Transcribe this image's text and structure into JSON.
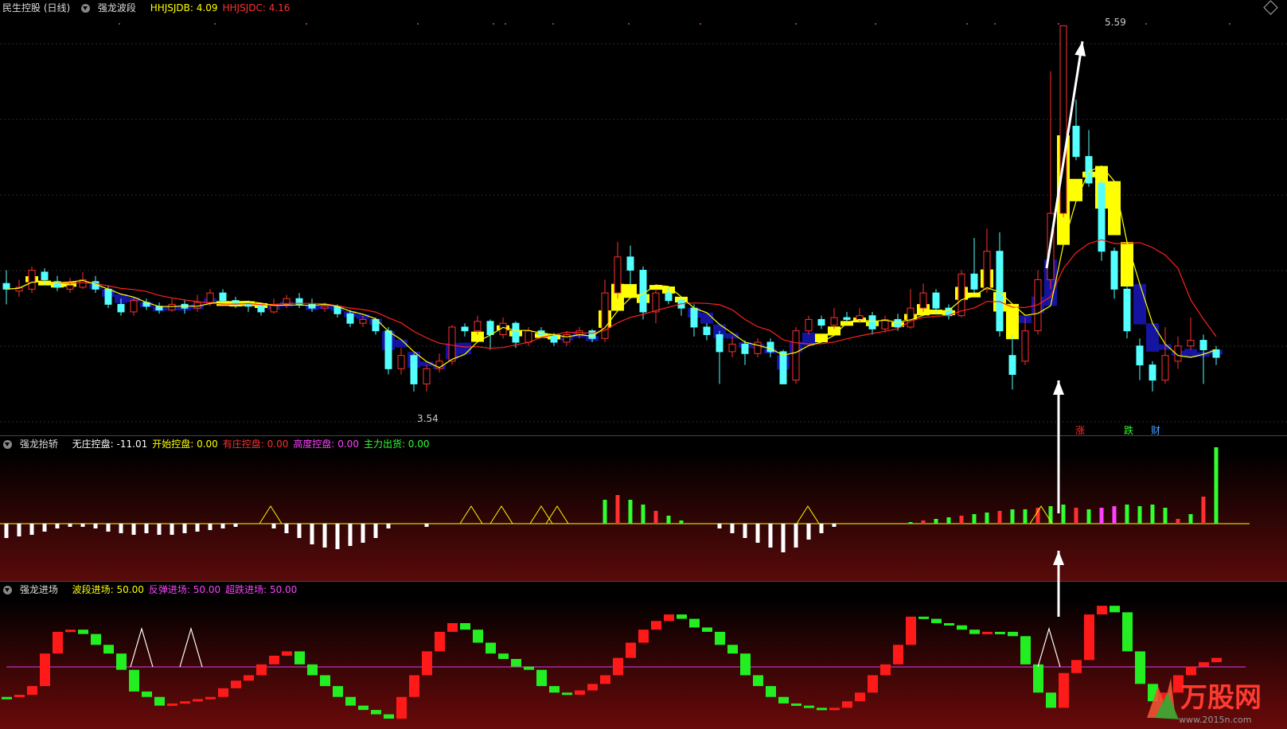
{
  "main": {
    "title": "民生控股 (日线)",
    "indicator_name": "强龙波段",
    "fields": [
      {
        "label": "HHJSJDB:",
        "value": "4.09",
        "color": "#ffff00"
      },
      {
        "label": "HHJSJDC:",
        "value": "4.16",
        "color": "#ff3030"
      }
    ],
    "high_label": "5.59",
    "low_label": "3.54",
    "signals": [
      {
        "text": "涨",
        "color": "#ff3030"
      },
      {
        "text": "跌",
        "color": "#30ff30"
      },
      {
        "text": "财",
        "color": "#4aa3ff"
      }
    ]
  },
  "ind1": {
    "name": "强龙抬轿",
    "fields": [
      {
        "label": "无庄控盘:",
        "value": "-11.01",
        "color": "#ffffff"
      },
      {
        "label": "开始控盘:",
        "value": "0.00",
        "color": "#ffff00"
      },
      {
        "label": "有庄控盘:",
        "value": "0.00",
        "color": "#ff3030"
      },
      {
        "label": "高度控盘:",
        "value": "0.00",
        "color": "#ff40ff"
      },
      {
        "label": "主力出货:",
        "value": "0.00",
        "color": "#30ff30"
      }
    ]
  },
  "ind2": {
    "name": "强龙进场",
    "fields": [
      {
        "label": "波段进场:",
        "value": "50.00",
        "color": "#ffff00"
      },
      {
        "label": "反弹进场:",
        "value": "50.00",
        "color": "#ff40ff"
      },
      {
        "label": "超跌进场:",
        "value": "50.00",
        "color": "#ff40ff"
      }
    ]
  },
  "watermark": {
    "text": "万股网",
    "url": "www.2015n.com"
  },
  "colors": {
    "up": "#ff3030",
    "down": "#54ffff",
    "ma_short": "#ffff00",
    "ma_long": "#ff2020",
    "band_up": "#ffff00",
    "band_down": "#1414a0"
  },
  "chart_data": {
    "type": "candlestick",
    "price_range": [
      3.5,
      5.6
    ],
    "max_price": 5.59,
    "min_price": 3.54,
    "candles_open_close_high_low": [
      [
        4.23,
        4.2,
        4.3,
        4.12
      ],
      [
        4.19,
        4.21,
        4.25,
        4.16
      ],
      [
        4.2,
        4.3,
        4.32,
        4.18
      ],
      [
        4.29,
        4.25,
        4.31,
        4.22
      ],
      [
        4.24,
        4.21,
        4.27,
        4.19
      ],
      [
        4.2,
        4.22,
        4.26,
        4.18
      ],
      [
        4.21,
        4.25,
        4.29,
        4.2
      ],
      [
        4.24,
        4.2,
        4.27,
        4.18
      ],
      [
        4.2,
        4.12,
        4.22,
        4.1
      ],
      [
        4.12,
        4.08,
        4.15,
        4.06
      ],
      [
        4.08,
        4.14,
        4.16,
        4.06
      ],
      [
        4.13,
        4.11,
        4.15,
        4.09
      ],
      [
        4.11,
        4.09,
        4.13,
        4.07
      ],
      [
        4.09,
        4.12,
        4.15,
        4.08
      ],
      [
        4.12,
        4.1,
        4.14,
        4.07
      ],
      [
        4.1,
        4.13,
        4.17,
        4.08
      ],
      [
        4.13,
        4.18,
        4.2,
        4.11
      ],
      [
        4.18,
        4.14,
        4.2,
        4.12
      ],
      [
        4.14,
        4.12,
        4.16,
        4.1
      ],
      [
        4.12,
        4.11,
        4.14,
        4.08
      ],
      [
        4.11,
        4.08,
        4.13,
        4.06
      ],
      [
        4.08,
        4.12,
        4.15,
        4.07
      ],
      [
        4.12,
        4.15,
        4.17,
        4.1
      ],
      [
        4.15,
        4.12,
        4.18,
        4.1
      ],
      [
        4.12,
        4.1,
        4.15,
        4.08
      ],
      [
        4.1,
        4.11,
        4.13,
        4.08
      ],
      [
        4.11,
        4.07,
        4.12,
        4.05
      ],
      [
        4.07,
        4.02,
        4.09,
        4.0
      ],
      [
        4.02,
        4.04,
        4.06,
        4.0
      ],
      [
        4.04,
        3.98,
        4.05,
        3.96
      ],
      [
        3.98,
        3.78,
        4.0,
        3.75
      ],
      [
        3.78,
        3.85,
        3.89,
        3.75
      ],
      [
        3.85,
        3.7,
        3.86,
        3.66
      ],
      [
        3.7,
        3.78,
        3.8,
        3.66
      ],
      [
        3.78,
        3.82,
        3.86,
        3.76
      ],
      [
        3.82,
        4.0,
        4.01,
        3.8
      ],
      [
        4.0,
        3.98,
        4.02,
        3.95
      ],
      [
        3.98,
        4.03,
        4.06,
        3.96
      ],
      [
        4.03,
        3.96,
        4.04,
        3.88
      ],
      [
        3.96,
        4.02,
        4.05,
        3.94
      ],
      [
        4.02,
        3.92,
        4.03,
        3.89
      ],
      [
        3.92,
        3.98,
        4.0,
        3.9
      ],
      [
        3.98,
        3.96,
        4.0,
        3.94
      ],
      [
        3.96,
        3.92,
        3.97,
        3.9
      ],
      [
        3.92,
        3.96,
        3.98,
        3.9
      ],
      [
        3.96,
        3.98,
        4.0,
        3.94
      ],
      [
        3.98,
        3.94,
        3.99,
        3.92
      ],
      [
        3.94,
        4.18,
        4.25,
        3.92
      ],
      [
        4.18,
        4.37,
        4.45,
        4.15
      ],
      [
        4.37,
        4.3,
        4.43,
        4.22
      ],
      [
        4.3,
        4.08,
        4.32,
        4.04
      ],
      [
        4.08,
        4.18,
        4.2,
        4.02
      ],
      [
        4.18,
        4.14,
        4.21,
        4.12
      ],
      [
        4.14,
        4.1,
        4.16,
        4.06
      ],
      [
        4.1,
        4.0,
        4.12,
        3.95
      ],
      [
        4.0,
        3.96,
        4.02,
        3.93
      ],
      [
        3.96,
        3.87,
        3.98,
        3.7
      ],
      [
        3.87,
        3.91,
        3.95,
        3.84
      ],
      [
        3.91,
        3.86,
        3.93,
        3.8
      ],
      [
        3.86,
        3.92,
        3.94,
        3.84
      ],
      [
        3.92,
        3.87,
        3.94,
        3.84
      ],
      [
        3.87,
        3.7,
        3.88,
        3.7
      ],
      [
        3.72,
        3.98,
        4.0,
        3.7
      ],
      [
        3.98,
        4.04,
        4.06,
        3.96
      ],
      [
        4.04,
        4.01,
        4.06,
        3.99
      ],
      [
        4.01,
        4.05,
        4.1,
        3.99
      ],
      [
        4.05,
        4.04,
        4.08,
        4.02
      ],
      [
        4.04,
        4.06,
        4.1,
        4.02
      ],
      [
        4.06,
        3.99,
        4.08,
        3.96
      ],
      [
        3.99,
        4.04,
        4.06,
        3.97
      ],
      [
        4.04,
        4.0,
        4.07,
        3.98
      ],
      [
        4.0,
        4.1,
        4.2,
        3.99
      ],
      [
        4.1,
        4.18,
        4.23,
        4.08
      ],
      [
        4.18,
        4.1,
        4.2,
        4.07
      ],
      [
        4.1,
        4.06,
        4.12,
        4.04
      ],
      [
        4.06,
        4.28,
        4.3,
        4.05
      ],
      [
        4.28,
        4.2,
        4.47,
        4.18
      ],
      [
        4.2,
        4.4,
        4.52,
        4.18
      ],
      [
        4.4,
        3.98,
        4.5,
        3.95
      ],
      [
        3.85,
        3.75,
        3.96,
        3.67
      ],
      [
        3.82,
        3.98,
        4.05,
        3.8
      ],
      [
        3.98,
        4.25,
        4.3,
        3.96
      ],
      [
        4.25,
        4.6,
        5.35,
        4.2
      ],
      [
        4.6,
        5.59,
        5.59,
        4.58
      ],
      [
        5.06,
        4.9,
        5.2,
        4.88
      ],
      [
        4.9,
        4.76,
        5.04,
        4.74
      ],
      [
        4.76,
        4.4,
        4.78,
        4.35
      ],
      [
        4.4,
        4.2,
        4.42,
        4.15
      ],
      [
        4.2,
        3.98,
        4.22,
        3.94
      ],
      [
        3.9,
        3.8,
        3.94,
        3.72
      ],
      [
        3.8,
        3.72,
        3.82,
        3.66
      ],
      [
        3.72,
        3.85,
        4.0,
        3.7
      ],
      [
        3.82,
        3.9,
        3.95,
        3.78
      ],
      [
        3.9,
        3.93,
        4.05,
        3.88
      ],
      [
        3.93,
        3.88,
        3.96,
        3.7
      ],
      [
        3.88,
        3.84,
        3.9,
        3.8
      ]
    ],
    "y_axis": "price",
    "x_axis": "trading days"
  }
}
